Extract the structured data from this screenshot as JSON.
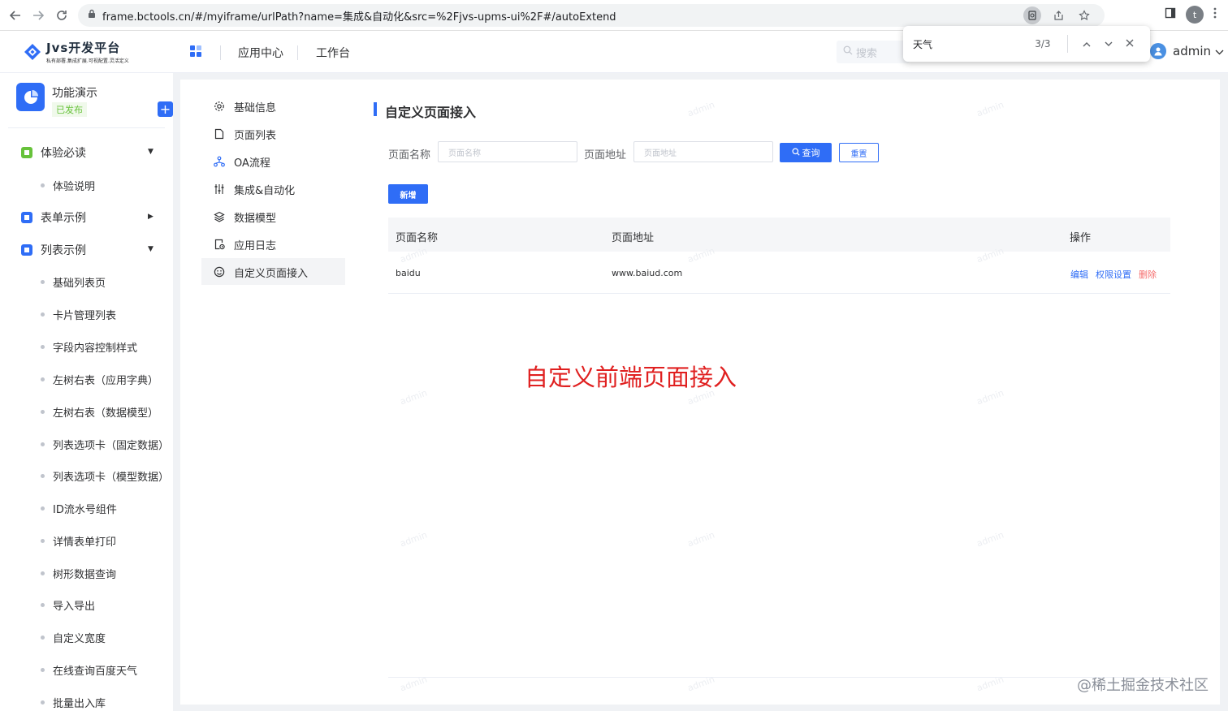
{
  "browser": {
    "url": "frame.bctools.cn/#/myiframe/urlPath?name=集成&自动化&src=%2Fjvs-upms-ui%2F#/autoExtend",
    "profile_initial": "t"
  },
  "find_bar": {
    "query": "天气",
    "count": "3/3"
  },
  "header": {
    "logo_title": "Jvs开发平台",
    "logo_subtitle": "私有部署.集成扩展.可视配置.灵活定义",
    "nav": [
      "应用中心",
      "工作台"
    ],
    "search_placeholder": "搜索",
    "username": "admin"
  },
  "app": {
    "name": "功能演示",
    "status": "已发布",
    "add_label": "+"
  },
  "sidebar": {
    "groups": [
      {
        "label": "体验必读",
        "items": [
          "体验说明"
        ]
      },
      {
        "label": "表单示例",
        "items": []
      },
      {
        "label": "列表示例",
        "items": [
          "基础列表页",
          "卡片管理列表",
          "字段内容控制样式",
          "左树右表（应用字典）",
          "左树右表（数据模型）",
          "列表选项卡（固定数据）",
          "列表选项卡（模型数据）",
          "ID流水号组件",
          "详情表单打印",
          "树形数据查询",
          "导入导出",
          "自定义宽度",
          "在线查询百度天气",
          "批量出入库"
        ]
      }
    ]
  },
  "subnav": {
    "items": [
      "基础信息",
      "页面列表",
      "OA流程",
      "集成&自动化",
      "数据模型",
      "应用日志",
      "自定义页面接入"
    ],
    "active": "自定义页面接入"
  },
  "page": {
    "title": "自定义页面接入",
    "filters": [
      {
        "label": "页面名称",
        "placeholder": "页面名称"
      },
      {
        "label": "页面地址",
        "placeholder": "页面地址"
      }
    ],
    "query_label": "查询",
    "reset_label": "重置",
    "add_label": "新增",
    "table": {
      "columns": [
        "页面名称",
        "页面地址",
        "操作"
      ],
      "rows": [
        {
          "name": "baidu",
          "address": "www.baiud.com",
          "actions": [
            "编辑",
            "权限设置",
            "删除"
          ]
        }
      ]
    },
    "annotation": "自定义前端页面接入",
    "watermark": "admin"
  },
  "credit": "@稀土掘金技术社区",
  "colors": {
    "primary": "#2f6df6",
    "danger": "#f56c6c",
    "success": "#67c23a",
    "annotation": "#e02020"
  }
}
